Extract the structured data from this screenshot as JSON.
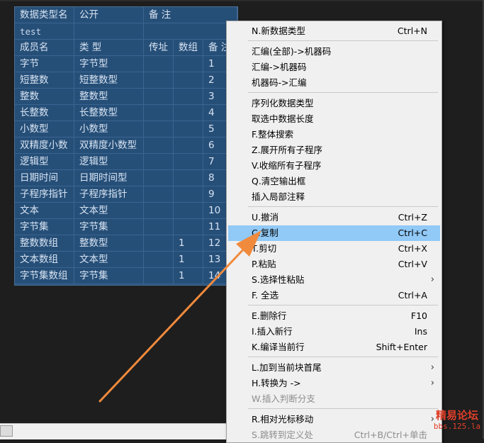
{
  "table": {
    "header": [
      "数据类型名",
      "公开",
      "备 注"
    ],
    "type_name": "test",
    "member_header": [
      "成员名",
      "类 型",
      "传址",
      "数组",
      "备 注"
    ],
    "rows": [
      {
        "name": "字节",
        "type": "字节型",
        "byref": "",
        "array": "",
        "note": "1"
      },
      {
        "name": "短整数",
        "type": "短整数型",
        "byref": "",
        "array": "",
        "note": "2"
      },
      {
        "name": "整数",
        "type": "整数型",
        "byref": "",
        "array": "",
        "note": "3"
      },
      {
        "name": "长整数",
        "type": "长整数型",
        "byref": "",
        "array": "",
        "note": "4"
      },
      {
        "name": "小数型",
        "type": "小数型",
        "byref": "",
        "array": "",
        "note": "5"
      },
      {
        "name": "双精度小数",
        "type": "双精度小数型",
        "byref": "",
        "array": "",
        "note": "6"
      },
      {
        "name": "逻辑型",
        "type": "逻辑型",
        "byref": "",
        "array": "",
        "note": "7"
      },
      {
        "name": "日期时间",
        "type": "日期时间型",
        "byref": "",
        "array": "",
        "note": "8"
      },
      {
        "name": "子程序指针",
        "type": "子程序指针",
        "byref": "",
        "array": "",
        "note": "9"
      },
      {
        "name": "文本",
        "type": "文本型",
        "byref": "",
        "array": "",
        "note": "10"
      },
      {
        "name": "字节集",
        "type": "字节集",
        "byref": "",
        "array": "",
        "note": "11"
      },
      {
        "name": "整数数组",
        "type": "整数型",
        "byref": "",
        "array": "1",
        "note": "12"
      },
      {
        "name": "文本数组",
        "type": "文本型",
        "byref": "",
        "array": "1",
        "note": "13"
      },
      {
        "name": "字节集数组",
        "type": "字节集",
        "byref": "",
        "array": "1",
        "note": "14"
      }
    ]
  },
  "menu": {
    "items": [
      {
        "label": "N.新数据类型",
        "shortcut": "Ctrl+N"
      },
      {
        "label": "汇编(全部)->机器码",
        "shortcut": ""
      },
      {
        "label": "汇编->机器码",
        "shortcut": ""
      },
      {
        "label": "机器码->汇编",
        "shortcut": ""
      },
      {
        "label": "序列化数据类型",
        "shortcut": ""
      },
      {
        "label": "取选中数据长度",
        "shortcut": ""
      },
      {
        "label": "F.整体搜索",
        "shortcut": ""
      },
      {
        "label": "Z.展开所有子程序",
        "shortcut": ""
      },
      {
        "label": "V.收缩所有子程序",
        "shortcut": ""
      },
      {
        "label": "Q.清空输出框",
        "shortcut": ""
      },
      {
        "label": "插入局部注释",
        "shortcut": ""
      },
      {
        "label": "U.撤消",
        "shortcut": "Ctrl+Z"
      },
      {
        "label": "C.复制",
        "shortcut": "Ctrl+C"
      },
      {
        "label": "T.剪切",
        "shortcut": "Ctrl+X"
      },
      {
        "label": "P.粘贴",
        "shortcut": "Ctrl+V"
      },
      {
        "label": "S.选择性粘贴",
        "shortcut": "",
        "submenu": "›"
      },
      {
        "label": "F. 全选",
        "shortcut": "Ctrl+A"
      },
      {
        "label": "E.删除行",
        "shortcut": "F10"
      },
      {
        "label": "I.插入新行",
        "shortcut": "Ins"
      },
      {
        "label": "K.编译当前行",
        "shortcut": "Shift+Enter"
      },
      {
        "label": "L.加到当前块首尾",
        "shortcut": "",
        "submenu": "›"
      },
      {
        "label": "H.转换为 ->",
        "shortcut": "",
        "submenu": "›"
      },
      {
        "label": "W.插入判断分支",
        "shortcut": ""
      },
      {
        "label": "R.相对光标移动",
        "shortcut": "",
        "submenu": "›"
      },
      {
        "label": "S.跳转到定义处",
        "shortcut": "Ctrl+B/Ctrl+单击"
      }
    ]
  },
  "watermark": {
    "line1": "精易论坛",
    "line2": "bbs.125.la"
  },
  "colors": {
    "table_bg": "#264f78",
    "highlight": "#91c9f7",
    "arrow": "#f08a3c",
    "watermark": "#e0402a"
  }
}
